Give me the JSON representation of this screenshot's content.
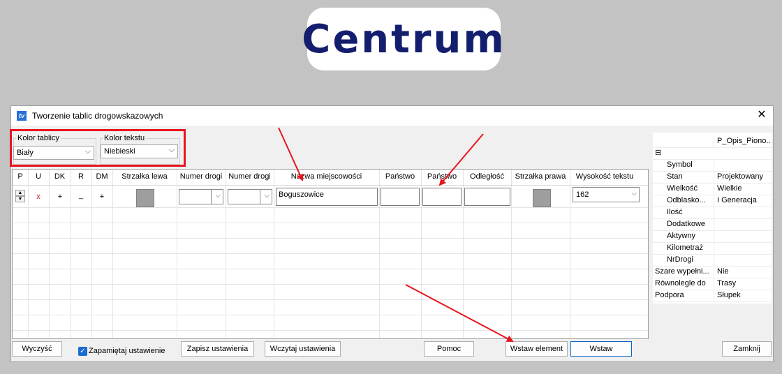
{
  "logo": {
    "text": "Centrum"
  },
  "window": {
    "title": "Tworzenie tablic drogowskazowych",
    "close_glyph": "✕"
  },
  "colors": {
    "highlight": "#e8141e",
    "logo_text": "#141e6e",
    "checkbox": "#1a6cd1"
  },
  "kolor_tablicy": {
    "label": "Kolor tablicy",
    "value": "Biały"
  },
  "kolor_tekstu": {
    "label": "Kolor tekstu",
    "value": "Niebieski"
  },
  "grid": {
    "headers": [
      "P",
      "U",
      "DK",
      "R",
      "DM",
      "Strzałka lewa",
      "Numer drogi",
      "Numer drogi",
      "Nazwa miejscowości",
      "Państwo",
      "Państwo",
      "Odległość",
      "Strzałka prawa",
      "Wysokość tekstu"
    ],
    "row": {
      "u": "x",
      "dk": "+",
      "r": "_",
      "dm": "+",
      "nazwa": "Boguszowice",
      "wysokosc": "162"
    }
  },
  "properties": {
    "header_value": "P_Opis_Piono...",
    "collapse_glyph": "⊟",
    "rows": [
      {
        "key": "Symbol",
        "value": ""
      },
      {
        "key": "Stan",
        "value": "Projektowany"
      },
      {
        "key": "Wielkość",
        "value": "Wielkie"
      },
      {
        "key": "Odblasko...",
        "value": "I Generacja"
      },
      {
        "key": "Ilość",
        "value": ""
      },
      {
        "key": "Dodatkowe",
        "value": ""
      },
      {
        "key": "Aktywny",
        "value": ""
      },
      {
        "key": "Kilometraż",
        "value": ""
      },
      {
        "key": "NrDrogi",
        "value": ""
      },
      {
        "key": "Szare wypełni...",
        "value": "Nie"
      },
      {
        "key": "Równolegle do",
        "value": "Trasy"
      },
      {
        "key": "Podpora",
        "value": "Słupek"
      }
    ]
  },
  "buttons": {
    "wyczysc": "Wyczyść",
    "zapamietaj": "Zapamiętaj ustawienie",
    "zapisz": "Zapisz ustawienia",
    "wczytaj": "Wczytaj ustawienia",
    "pomoc": "Pomoc",
    "wstaw_element": "Wstaw element",
    "wstaw": "Wstaw",
    "zamknij": "Zamknij"
  },
  "icons": {
    "chevron": "⌵",
    "check": "✓",
    "spin_up": "▲",
    "spin_down": "▼"
  }
}
